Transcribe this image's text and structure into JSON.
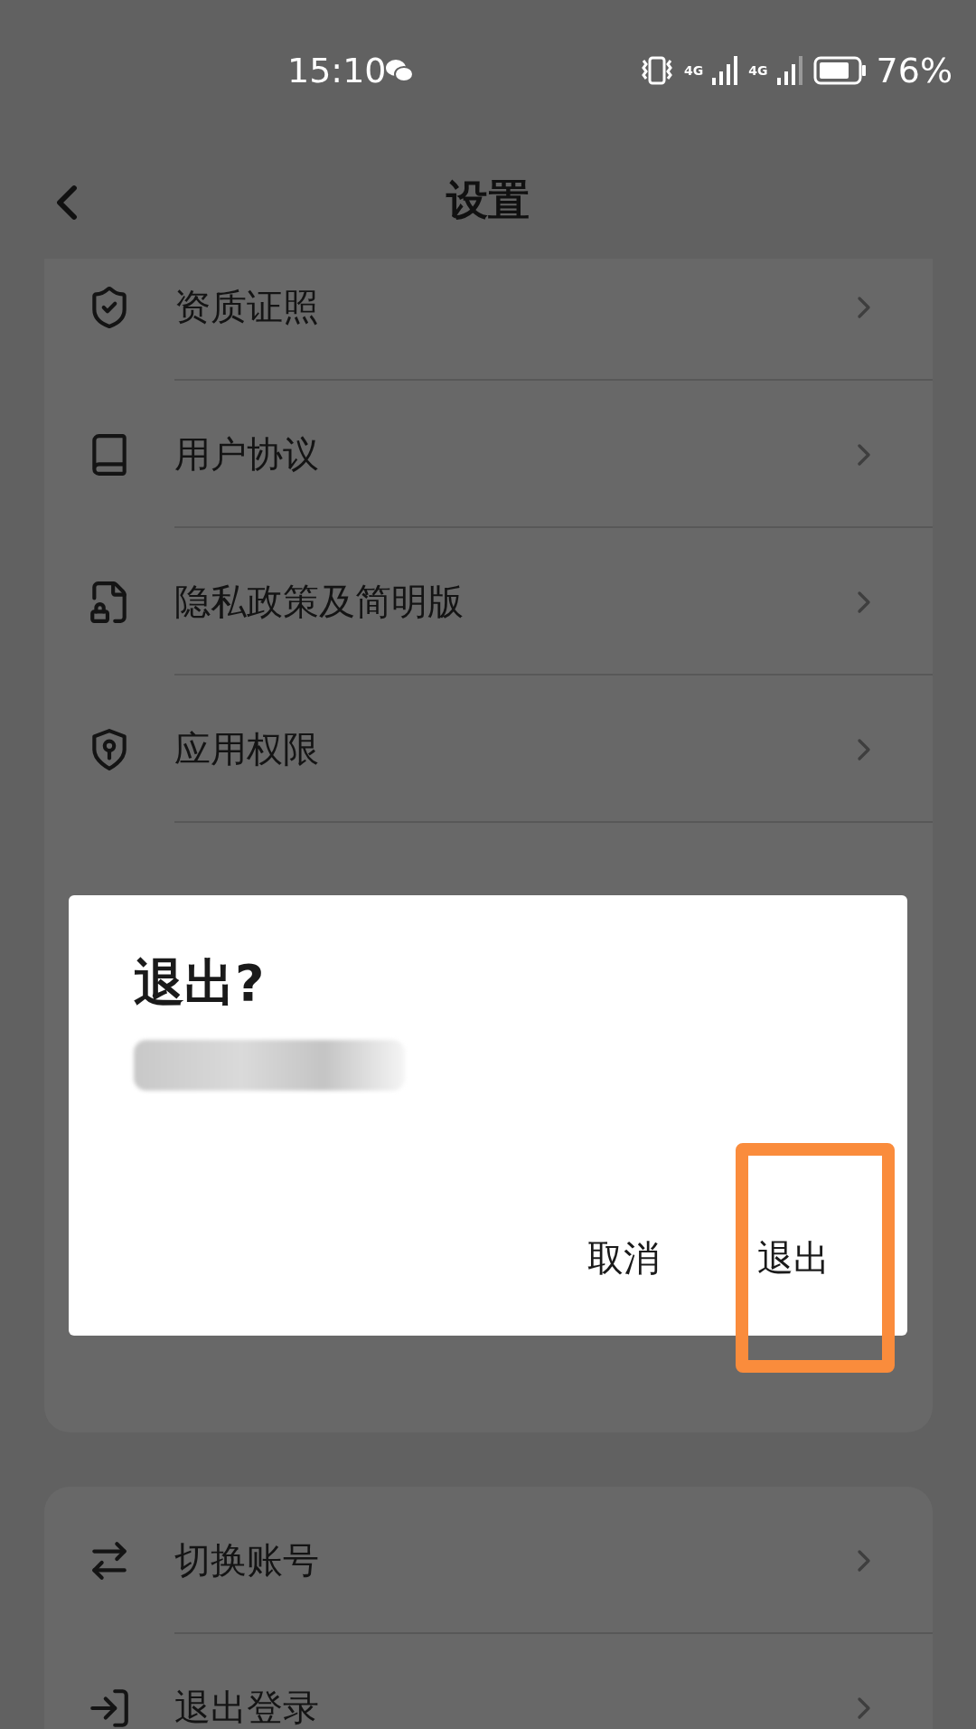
{
  "status_bar": {
    "time": "15:10",
    "network_1": "4G",
    "network_2": "4G",
    "battery": "76%"
  },
  "header": {
    "title": "设置"
  },
  "groups": [
    {
      "items": [
        {
          "label": "资质证照"
        },
        {
          "label": "用户协议"
        },
        {
          "label": "隐私政策及简明版"
        },
        {
          "label": "应用权限"
        }
      ]
    },
    {
      "items": [
        {
          "label": "切换账号"
        },
        {
          "label": "退出登录"
        }
      ]
    }
  ],
  "dialog": {
    "title": "退出?",
    "buttons": [
      {
        "label": "取消",
        "highlighted": false
      },
      {
        "label": "退出",
        "highlighted": true
      }
    ]
  }
}
